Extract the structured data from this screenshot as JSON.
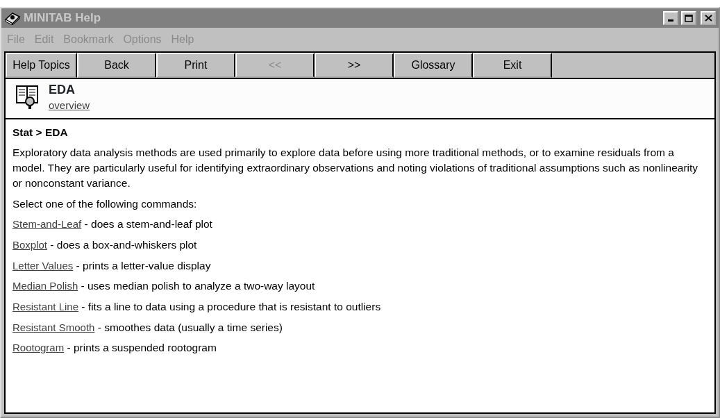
{
  "window": {
    "title": "MINITAB Help",
    "active": false
  },
  "menu": [
    {
      "label": "File"
    },
    {
      "label": "Edit"
    },
    {
      "label": "Bookmark"
    },
    {
      "label": "Options"
    },
    {
      "label": "Help"
    }
  ],
  "toolbar": [
    {
      "label": "Help Topics",
      "disabled": false
    },
    {
      "label": "Back",
      "disabled": false
    },
    {
      "label": "Print",
      "disabled": false
    },
    {
      "label": "<<",
      "disabled": true
    },
    {
      "label": ">>",
      "disabled": false
    },
    {
      "label": "Glossary",
      "disabled": false
    },
    {
      "label": "Exit",
      "disabled": false
    }
  ],
  "topic": {
    "title": "EDA",
    "link": "overview"
  },
  "path": "Stat > EDA",
  "intro": "Exploratory data analysis methods are used primarily to explore data before using more traditional methods, or to examine residuals from a model. They are particularly useful for identifying extraordinary observations and noting violations of traditional assumptions such as nonlinearity or nonconstant variance.",
  "prompt": "Select one of the following commands:",
  "commands": [
    {
      "link": "Stem-and-Leaf",
      "description": " - does a stem-and-leaf plot"
    },
    {
      "link": "Boxplot",
      "description": " - does a box-and-whiskers plot"
    },
    {
      "link": "Letter Values",
      "description": " - prints a letter-value display"
    },
    {
      "link": "Median Polish",
      "description": " - uses median polish to analyze a two-way layout"
    },
    {
      "link": "Resistant Line",
      "description": " - fits a line to data using a procedure that is resistant to outliers"
    },
    {
      "link": "Resistant Smooth",
      "description": " - smoothes data (usually a time series)"
    },
    {
      "link": "Rootogram",
      "description": " - prints a suspended rootogram"
    }
  ]
}
